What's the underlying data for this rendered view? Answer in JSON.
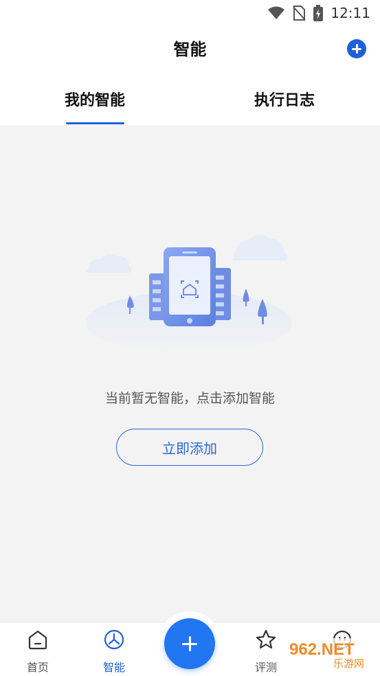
{
  "status_bar": {
    "time": "12:11"
  },
  "header": {
    "title": "智能"
  },
  "tabs": [
    {
      "label": "我的智能",
      "active": true
    },
    {
      "label": "执行日志",
      "active": false
    }
  ],
  "empty_state": {
    "message": "当前暂无智能，点击添加智能",
    "button_label": "立即添加"
  },
  "bottom_nav": {
    "items": [
      {
        "label": "首页",
        "icon": "home-icon"
      },
      {
        "label": "智能",
        "icon": "smart-icon",
        "active": true
      },
      {
        "label": "评测",
        "icon": "star-icon"
      },
      {
        "label": "",
        "icon": "face-icon"
      }
    ],
    "center_icon": "plus-icon"
  },
  "watermark": {
    "text": "962.NET",
    "sub": "乐游网"
  },
  "colors": {
    "accent": "#1f5fd9",
    "fab": "#2176f2",
    "background": "#f3f3f3"
  }
}
